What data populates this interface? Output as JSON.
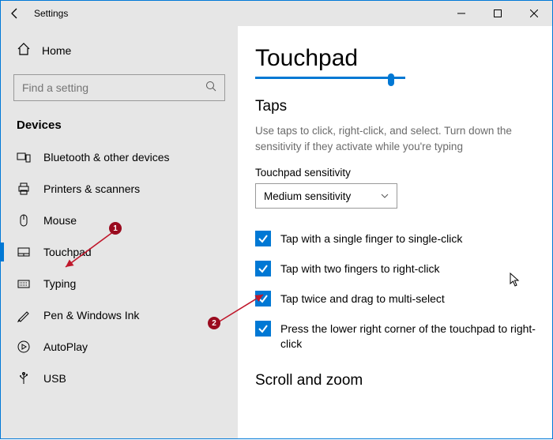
{
  "window": {
    "title": "Settings"
  },
  "sidebar": {
    "home": "Home",
    "search_placeholder": "Find a setting",
    "section": "Devices",
    "items": [
      {
        "label": "Bluetooth & other devices"
      },
      {
        "label": "Printers & scanners"
      },
      {
        "label": "Mouse"
      },
      {
        "label": "Touchpad"
      },
      {
        "label": "Typing"
      },
      {
        "label": "Pen & Windows Ink"
      },
      {
        "label": "AutoPlay"
      },
      {
        "label": "USB"
      }
    ]
  },
  "main": {
    "title": "Touchpad",
    "taps_heading": "Taps",
    "taps_desc": "Use taps to click, right-click, and select. Turn down the sensitivity if they activate while you're typing",
    "sensitivity_label": "Touchpad sensitivity",
    "sensitivity_value": "Medium sensitivity",
    "checks": [
      "Tap with a single finger to single-click",
      "Tap with two fingers to right-click",
      "Tap twice and drag to multi-select",
      "Press the lower right corner of the touchpad to right-click"
    ],
    "scroll_heading": "Scroll and zoom"
  },
  "annotations": {
    "badge1": "1",
    "badge2": "2"
  }
}
